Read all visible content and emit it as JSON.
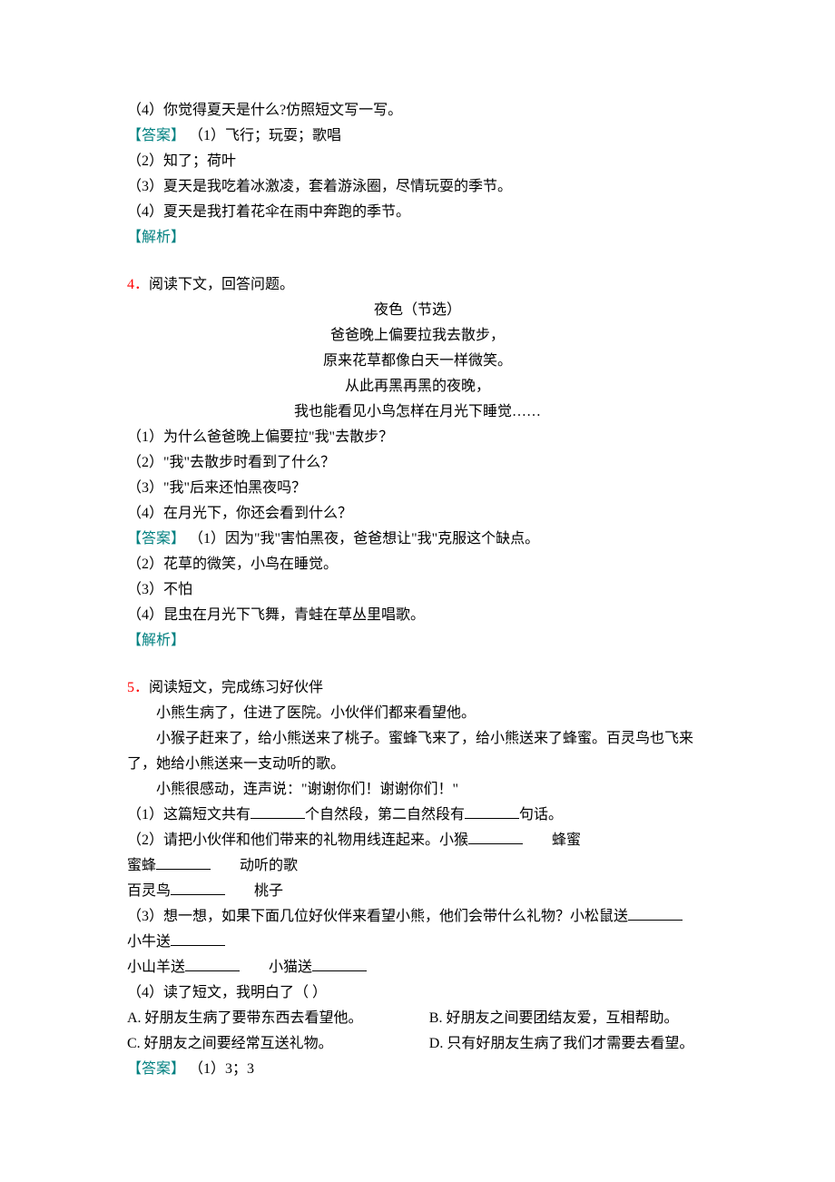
{
  "q3_tail": {
    "q4": "（4）你觉得夏天是什么?仿照短文写一写。",
    "ans_label": "【答案】",
    "ans1": " （1）飞行；玩耍；歌唱",
    "ans2": "（2）知了；荷叶",
    "ans3": "（3）夏天是我吃着冰激凌，套着游泳圈，尽情玩耍的季节。",
    "ans4": "（4）夏天是我打着花伞在雨中奔跑的季节。",
    "explain": "【解析】"
  },
  "q4": {
    "num": "4．",
    "title": "阅读下文，回答问题。",
    "poem_title": "夜色（节选）",
    "poem1": "爸爸晚上偏要拉我去散步，",
    "poem2": "原来花草都像白天一样微笑。",
    "poem3": "从此再黑再黑的夜晚，",
    "poem4": "我也能看见小鸟怎样在月光下睡觉……",
    "q1": "（1）为什么爸爸晚上偏要拉\"我\"去散步？",
    "q2": "（2）\"我\"去散步时看到了什么？",
    "q3": "（3）\"我\"后来还怕黑夜吗？",
    "q4": "（4）在月光下，你还会看到什么？",
    "ans_label": "【答案】",
    "ans1": " （1）因为\"我\"害怕黑夜，爸爸想让\"我\"克服这个缺点。",
    "ans2": "（2）花草的微笑，小鸟在睡觉。",
    "ans3": "（3）不怕",
    "ans4": "（4）昆虫在月光下飞舞，青蛙在草丛里唱歌。",
    "explain": "【解析】"
  },
  "q5": {
    "num": "5．",
    "title": "阅读短文，完成练习好伙伴",
    "p1": "　　小熊生病了，住进了医院。小伙伴们都来看望他。",
    "p2_a": "　　小猴子赶来了，给小熊送来了桃子。蜜蜂飞来了，给小熊送来了蜂蜜。百灵鸟也飞来",
    "p2_b": "了，她给小熊送来一支动听的歌。",
    "p3": "　　小熊很感动，连声说：\"谢谢你们！谢谢你们！\"",
    "q1_a": "（1）这篇短文共有",
    "q1_b": "个自然段，第二自然段有",
    "q1_c": "句话。",
    "q2_a": "（2）请把小伙伴和他们带来的礼物用线连起来。小猴",
    "q2_b": "　　蜂蜜",
    "line_mifeng_a": "蜜蜂",
    "line_mifeng_b": "　　动听的歌",
    "line_bailing_a": "百灵鸟",
    "line_bailing_b": "　　桃子",
    "q3_a": "（3）想一想，如果下面几位好伙伴来看望小熊，他们会带什么礼物？小松鼠送",
    "line_xiaoniu_a": "小牛送",
    "line_xiaoshanyang_a": "小山羊送",
    "line_xiaoshanyang_b": "　　小猫送",
    "q4": "（4）读了短文，我明白了（   ）",
    "optA": "A. 好朋友生病了要带东西去看望他。",
    "optB": "B. 好朋友之间要团结友爱，互相帮助。",
    "optC": "C. 好朋友之间要经常互送礼物。",
    "optD": "D. 只有好朋友生病了我们才需要去看望。",
    "ans_label": "【答案】",
    "ans1": " （1）3；3"
  }
}
